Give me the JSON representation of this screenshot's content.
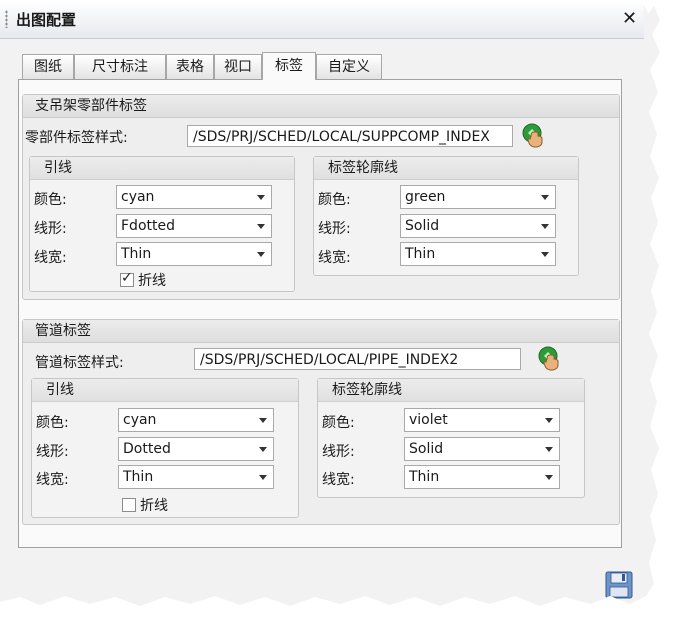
{
  "window": {
    "title": "出图配置"
  },
  "tabs": [
    {
      "label": "图纸"
    },
    {
      "label": "尺寸标注"
    },
    {
      "label": "表格"
    },
    {
      "label": "视口"
    },
    {
      "label": "标签",
      "active": true
    },
    {
      "label": "自定义"
    }
  ],
  "support_label": {
    "title": "支吊架零部件标签",
    "style_label": "零部件标签样式:",
    "style_value": "/SDS/PRJ/SCHED/LOCAL/SUPPCOMP_INDEX",
    "leader": {
      "title": "引线",
      "color_label": "颜色:",
      "color_value": "cyan",
      "linetype_label": "线形:",
      "linetype_value": "Fdotted",
      "linewidth_label": "线宽:",
      "linewidth_value": "Thin",
      "polyline_label": "折线",
      "polyline_checked": true
    },
    "outline": {
      "title": "标签轮廓线",
      "color_label": "颜色:",
      "color_value": "green",
      "linetype_label": "线形:",
      "linetype_value": "Solid",
      "linewidth_label": "线宽:",
      "linewidth_value": "Thin"
    }
  },
  "pipe_label": {
    "title": "管道标签",
    "style_label": "管道标签样式:",
    "style_value": "/SDS/PRJ/SCHED/LOCAL/PIPE_INDEX2",
    "leader": {
      "title": "引线",
      "color_label": "颜色:",
      "color_value": "cyan",
      "linetype_label": "线形:",
      "linetype_value": "Dotted",
      "linewidth_label": "线宽:",
      "linewidth_value": "Thin",
      "polyline_label": "折线",
      "polyline_checked": false
    },
    "outline": {
      "title": "标签轮廓线",
      "color_label": "颜色:",
      "color_value": "violet",
      "linetype_label": "线形:",
      "linetype_value": "Solid",
      "linewidth_label": "线宽:",
      "linewidth_value": "Thin"
    }
  },
  "icons": {
    "close": "close-icon",
    "browse": "browse-hand-icon",
    "save": "floppy-disk-icon"
  }
}
